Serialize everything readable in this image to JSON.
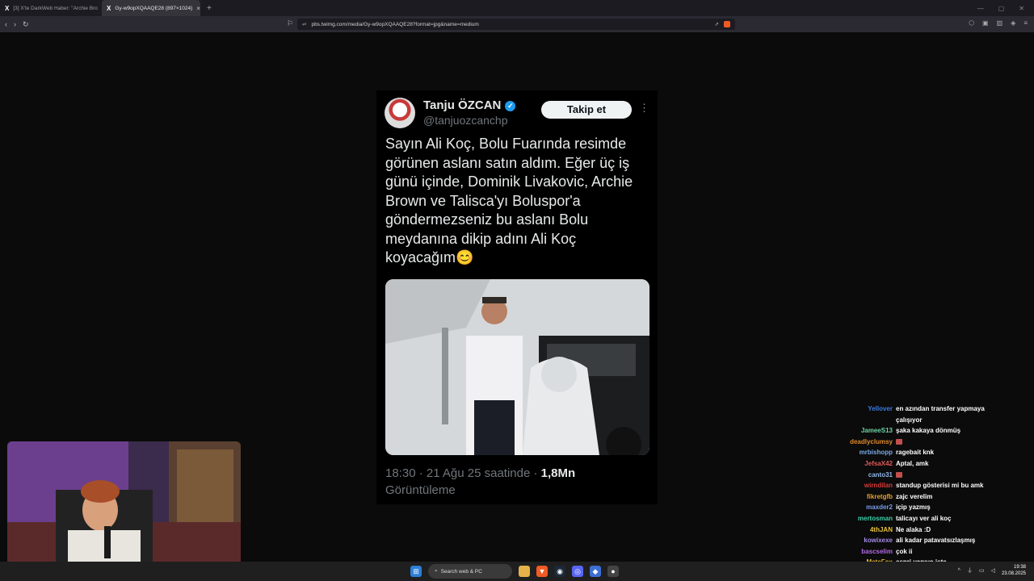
{
  "browser": {
    "tabs": [
      {
        "label": "[3] X'te DarkWeb Haber: \"Archie Bro"
      },
      {
        "label": "Gy-w9opXQAAQE28 (897×1024)"
      }
    ],
    "url": "pbs.twimg.com/media/Gy-w9opXQAAQE28?format=jpg&name=medium"
  },
  "tweet": {
    "name": "Tanju ÖZCAN",
    "handle": "@tanjuozcanchp",
    "follow_label": "Takip et",
    "text": "Sayın Ali Koç, Bolu Fuarında resimde görünen aslanı satın aldım. Eğer üç iş günü içinde, Dominik Livakovic, Archie Brown ve Talisca'yı Boluspor'a göndermezseniz bu aslanı Bolu meydanına dikip adını Ali Koç koyacağım😊",
    "time": "18:30 · 21 Ağu 25 saatinde · ",
    "views": "1,8Mn",
    "views_label": "Görüntüleme"
  },
  "chat": [
    {
      "user": "Yellover",
      "color": "#3c7ce0",
      "msg": "en azından transfer yapmaya çalışıyor"
    },
    {
      "user": "JameeS13",
      "color": "#6fd1a5",
      "msg": "şaka kakaya dönmüş"
    },
    {
      "user": "deadlyclumsy",
      "color": "#e0892b",
      "msg": ""
    },
    {
      "user": "mrbishopp",
      "color": "#7aa9e8",
      "msg": "ragebait knk"
    },
    {
      "user": "JefsaX42",
      "color": "#e05a5a",
      "msg": "Aptal, amk"
    },
    {
      "user": "canto31",
      "color": "#8fb8e8",
      "msg": ""
    },
    {
      "user": "wirndilan",
      "color": "#d83a3a",
      "msg": "standup gösterisi mi bu amk"
    },
    {
      "user": "fikretgfb",
      "color": "#e8a030",
      "msg": "zajc verelim"
    },
    {
      "user": "maxder2",
      "color": "#7a9ce8",
      "msg": "içip yazmış"
    },
    {
      "user": "mertosman",
      "color": "#3ad0a8",
      "msg": "talicayı ver ali koç"
    },
    {
      "user": "4thJAN",
      "color": "#e8c13a",
      "msg": "Ne alaka :D"
    },
    {
      "user": "kowixexe",
      "color": "#a58ae8",
      "msg": "ali kadar patavatsızlaşmış"
    },
    {
      "user": "bascselim",
      "color": "#b56ae8",
      "msg": "çok ii"
    },
    {
      "user": "MeteFox",
      "color": "#e8b83a",
      "msg": "espri yapıyo işte"
    }
  ],
  "taskbar": {
    "search_placeholder": "Search web & PC",
    "time": "19:38",
    "date": "23.08.2025"
  },
  "colors": {
    "accent": "#1d9bf0",
    "follow_bg": "#eff3f4",
    "brave": "#f15a24"
  }
}
